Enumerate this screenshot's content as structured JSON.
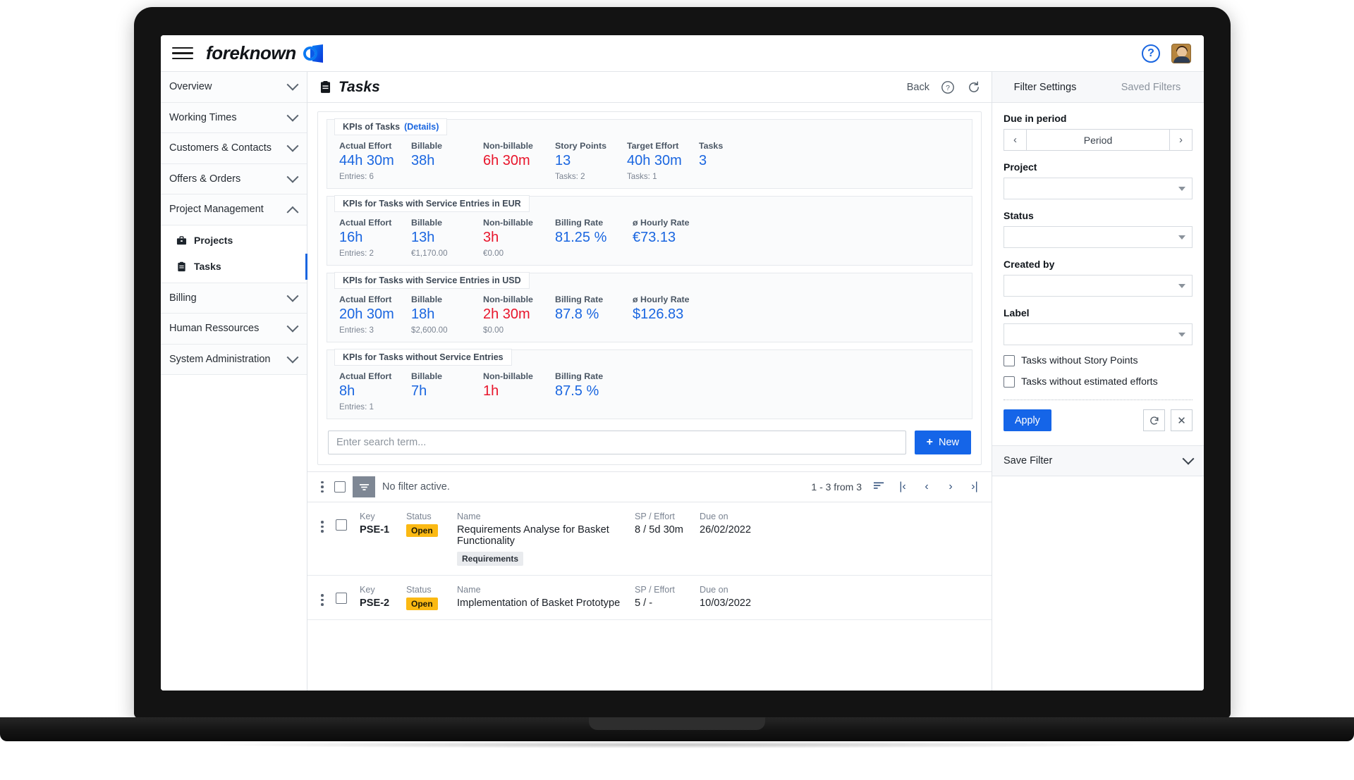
{
  "topbar": {
    "brand": "foreknown",
    "menu_icon": "hamburger-icon",
    "help_icon": "help-circle-icon",
    "avatar": "user-avatar"
  },
  "sidebar": {
    "groups": [
      {
        "label": "Overview",
        "expanded": false
      },
      {
        "label": "Working Times",
        "expanded": false
      },
      {
        "label": "Customers & Contacts",
        "expanded": false
      },
      {
        "label": "Offers & Orders",
        "expanded": false
      },
      {
        "label": "Project Management",
        "expanded": true
      },
      {
        "label": "Billing",
        "expanded": false
      },
      {
        "label": "Human Ressources",
        "expanded": false
      },
      {
        "label": "System Administration",
        "expanded": false
      }
    ],
    "sub_items": [
      {
        "label": "Projects",
        "icon": "briefcase-icon",
        "active": false
      },
      {
        "label": "Tasks",
        "icon": "clipboard-icon",
        "active": true
      }
    ]
  },
  "header": {
    "title": "Tasks",
    "icon": "clipboard-icon",
    "back_label": "Back",
    "help_icon": "help-circle-icon",
    "refresh_icon": "refresh-icon"
  },
  "kpi_sets": [
    {
      "legend": "KPIs of Tasks",
      "details_link": "(Details)",
      "cells": [
        {
          "label": "Actual Effort",
          "value": "44h 30m",
          "sub": "Entries: 6",
          "color": "blue"
        },
        {
          "label": "Billable",
          "value": "38h",
          "sub": "",
          "color": "blue"
        },
        {
          "label": "Non-billable",
          "value": "6h 30m",
          "sub": "",
          "color": "red"
        },
        {
          "label": "Story Points",
          "value": "13",
          "sub": "Tasks: 2",
          "color": "blue"
        },
        {
          "label": "Target Effort",
          "value": "40h 30m",
          "sub": "Tasks: 1",
          "color": "blue"
        },
        {
          "label": "Tasks",
          "value": "3",
          "sub": "",
          "color": "blue"
        }
      ]
    },
    {
      "legend": "KPIs for Tasks with Service Entries in EUR",
      "details_link": "",
      "cells": [
        {
          "label": "Actual Effort",
          "value": "16h",
          "sub": "Entries: 2",
          "color": "blue"
        },
        {
          "label": "Billable",
          "value": "13h",
          "sub": "€1,170.00",
          "color": "blue"
        },
        {
          "label": "Non-billable",
          "value": "3h",
          "sub": "€0.00",
          "color": "red"
        },
        {
          "label": "Billing Rate",
          "value": "81.25 %",
          "sub": "",
          "color": "blue"
        },
        {
          "label": "ø Hourly Rate",
          "value": "€73.13",
          "sub": "",
          "color": "blue"
        }
      ]
    },
    {
      "legend": "KPIs for Tasks with Service Entries in USD",
      "details_link": "",
      "cells": [
        {
          "label": "Actual Effort",
          "value": "20h 30m",
          "sub": "Entries: 3",
          "color": "blue"
        },
        {
          "label": "Billable",
          "value": "18h",
          "sub": "$2,600.00",
          "color": "blue"
        },
        {
          "label": "Non-billable",
          "value": "2h 30m",
          "sub": "$0.00",
          "color": "red"
        },
        {
          "label": "Billing Rate",
          "value": "87.8 %",
          "sub": "",
          "color": "blue"
        },
        {
          "label": "ø Hourly Rate",
          "value": "$126.83",
          "sub": "",
          "color": "blue"
        }
      ]
    },
    {
      "legend": "KPIs for Tasks without Service Entries",
      "details_link": "",
      "cells": [
        {
          "label": "Actual Effort",
          "value": "8h",
          "sub": "Entries: 1",
          "color": "blue"
        },
        {
          "label": "Billable",
          "value": "7h",
          "sub": "",
          "color": "blue"
        },
        {
          "label": "Non-billable",
          "value": "1h",
          "sub": "",
          "color": "red"
        },
        {
          "label": "Billing Rate",
          "value": "87.5 %",
          "sub": "",
          "color": "blue"
        }
      ]
    }
  ],
  "search": {
    "placeholder": "Enter search term...",
    "value": "",
    "new_label": "New"
  },
  "list_toolbar": {
    "filter_text": "No filter active.",
    "count_text": "1 - 3 from 3",
    "sort_icon": "sort-icon",
    "first_icon": "first-page-icon",
    "prev_icon": "prev-page-icon",
    "next_icon": "next-page-icon",
    "last_icon": "last-page-icon"
  },
  "table": {
    "headers": {
      "key": "Key",
      "status": "Status",
      "name": "Name",
      "sp_effort": "SP / Effort",
      "due_on": "Due on"
    },
    "rows": [
      {
        "key": "PSE-1",
        "status": "Open",
        "name": "Requirements Analyse for Basket Functionality",
        "tag": "Requirements",
        "sp_effort": "8 / 5d 30m",
        "due_on": "26/02/2022"
      },
      {
        "key": "PSE-2",
        "status": "Open",
        "name": "Implementation of Basket Prototype",
        "tag": "",
        "sp_effort": "5 / -",
        "due_on": "10/03/2022"
      }
    ]
  },
  "filter_panel": {
    "tabs": [
      {
        "label": "Filter Settings",
        "active": true
      },
      {
        "label": "Saved Filters",
        "active": false
      }
    ],
    "due_in_period": {
      "label": "Due in period",
      "value": "Period",
      "prev": "‹",
      "next": "›"
    },
    "project": {
      "label": "Project",
      "value": ""
    },
    "status": {
      "label": "Status",
      "value": ""
    },
    "created_by": {
      "label": "Created by",
      "value": ""
    },
    "label_field": {
      "label": "Label",
      "value": ""
    },
    "checkboxes": [
      {
        "label": "Tasks without Story Points",
        "checked": false
      },
      {
        "label": "Tasks without estimated efforts",
        "checked": false
      }
    ],
    "apply_label": "Apply",
    "reset_icon": "reset-icon",
    "clear_icon": "close-icon",
    "save_filter_label": "Save Filter"
  },
  "colors": {
    "accent": "#1565e8",
    "danger": "#e8152b",
    "badge": "#fbb913"
  }
}
